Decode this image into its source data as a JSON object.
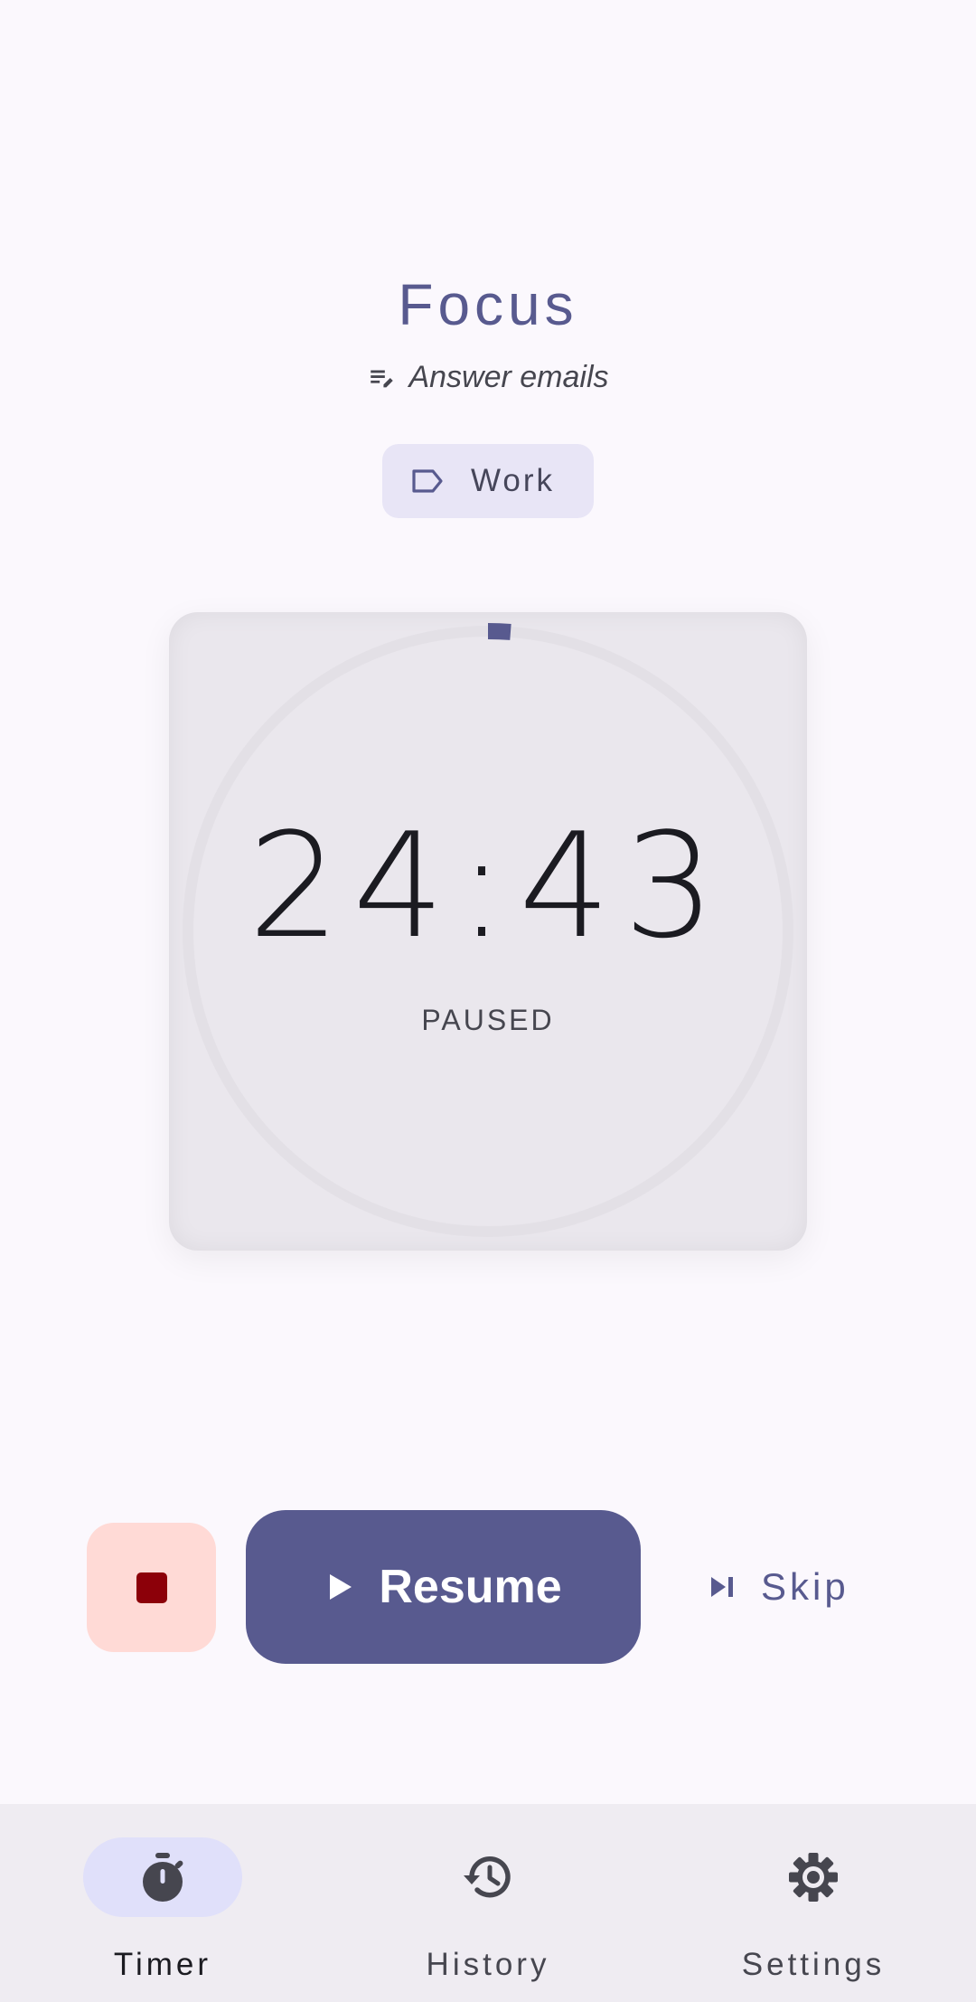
{
  "session": {
    "title": "Focus",
    "task": "Answer emails",
    "tag": "Work"
  },
  "timer": {
    "time": "24:43",
    "status": "PAUSED",
    "progress": 0.012
  },
  "controls": {
    "resume_label": "Resume",
    "skip_label": "Skip"
  },
  "nav": {
    "items": [
      {
        "label": "Timer",
        "icon": "stopwatch-icon",
        "active": true
      },
      {
        "label": "History",
        "icon": "history-icon",
        "active": false
      },
      {
        "label": "Settings",
        "icon": "gear-icon",
        "active": false
      }
    ]
  },
  "colors": {
    "primary": "#585a8f",
    "background": "#fbf8fd",
    "stop_container": "#ffdad6",
    "stop_icon": "#8c0009",
    "nav_active": "#e0e0fa"
  }
}
